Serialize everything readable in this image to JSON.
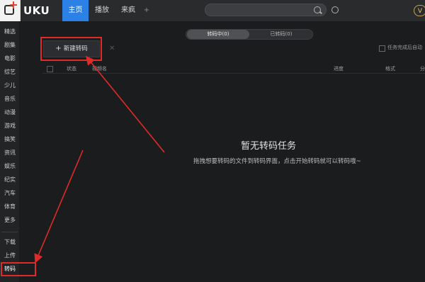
{
  "app": {
    "logo_text": "UKU",
    "logo_prefix": "",
    "tabs": [
      {
        "label": "主页",
        "active": true
      },
      {
        "label": "播放",
        "active": false
      },
      {
        "label": "来疯",
        "active": false
      },
      {
        "label": "+",
        "active": false
      }
    ],
    "search_placeholder": "",
    "user_badge": "V"
  },
  "sidebar": {
    "items": [
      "精选",
      "剧集",
      "电影",
      "综艺",
      "少儿",
      "音乐",
      "动漫",
      "游戏",
      "搞笑",
      "资讯",
      "娱乐",
      "纪实",
      "汽车",
      "体育",
      "更多"
    ],
    "bottom_items": [
      "下载",
      "上传",
      "转码"
    ],
    "active_item": "转码"
  },
  "transcode": {
    "segments": [
      {
        "label": "转码中(0)",
        "active": true
      },
      {
        "label": "已转码(0)",
        "active": false
      }
    ],
    "new_button": "新建转码",
    "auto_option": "任务完成后自动",
    "columns": [
      "状态",
      "视频名",
      "进度",
      "格式",
      "分"
    ],
    "empty_title": "暂无转码任务",
    "empty_desc": "拖拽想要转码的文件到转码界面，点击开始转码就可以转码哦~"
  },
  "colors": {
    "accent": "#2b81e6",
    "highlight_red": "#e02a2a",
    "background": "#1b1c1d"
  }
}
